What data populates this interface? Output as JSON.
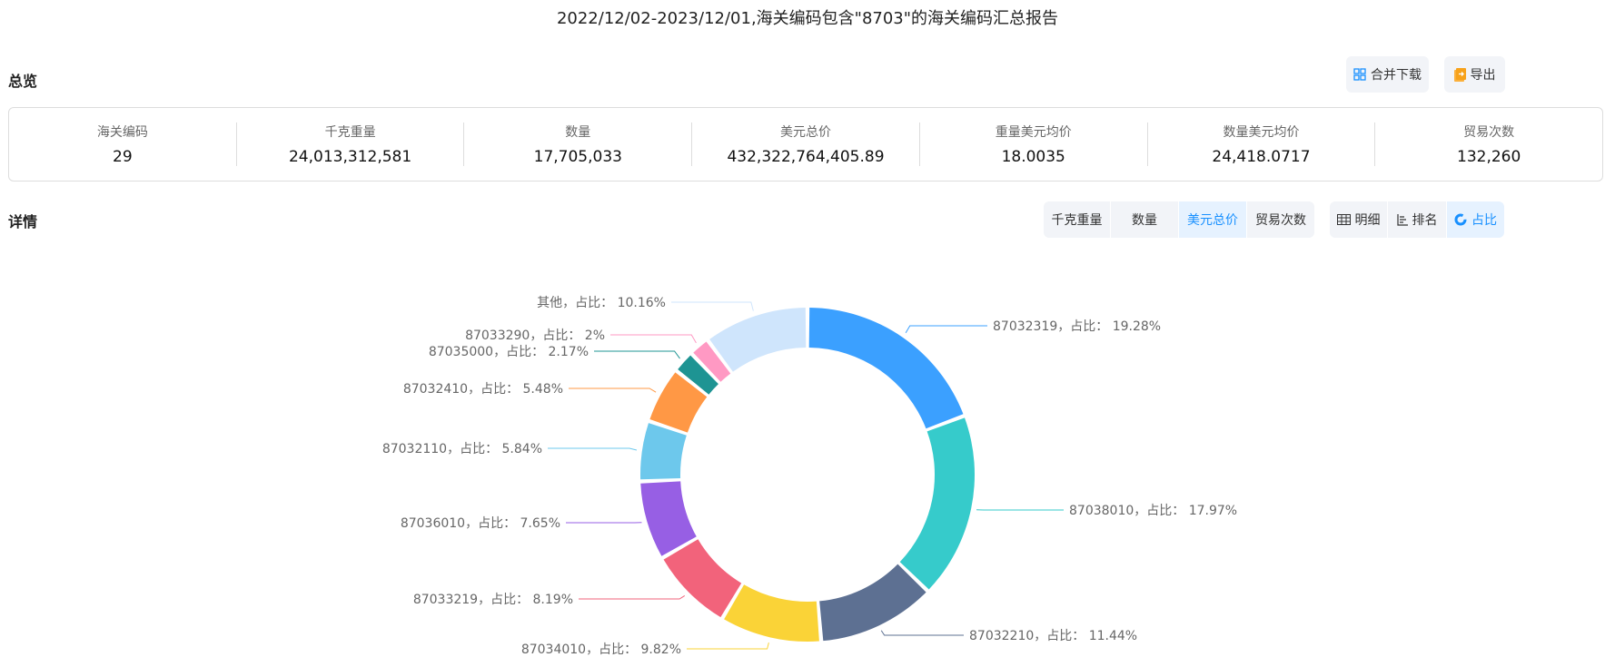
{
  "title": "2022/12/02-2023/12/01,海关编码包含\"8703\"的海关编码汇总报告",
  "overview": {
    "heading": "总览",
    "merge_download_label": "合并下载",
    "export_label": "导出",
    "stats": [
      {
        "label": "海关编码",
        "value": "29"
      },
      {
        "label": "千克重量",
        "value": "24,013,312,581"
      },
      {
        "label": "数量",
        "value": "17,705,033"
      },
      {
        "label": "美元总价",
        "value": "432,322,764,405.89"
      },
      {
        "label": "重量美元均价",
        "value": "18.0035"
      },
      {
        "label": "数量美元均价",
        "value": "24,418.0717"
      },
      {
        "label": "贸易次数",
        "value": "132,260"
      }
    ]
  },
  "details": {
    "heading": "详情",
    "metric_tabs": [
      {
        "label": "千克重量",
        "active": false
      },
      {
        "label": "数量",
        "active": false
      },
      {
        "label": "美元总价",
        "active": true
      },
      {
        "label": "贸易次数",
        "active": false
      }
    ],
    "view_tabs": [
      {
        "label": "明细",
        "icon": "table-icon",
        "active": false
      },
      {
        "label": "排名",
        "icon": "ranking-icon",
        "active": false
      },
      {
        "label": "占比",
        "icon": "donut-icon",
        "active": true
      }
    ]
  },
  "colors": {
    "accent": "#1890ff",
    "active_bg": "#e6f2ff",
    "button_bg": "#f2f4f8"
  },
  "chart_data": {
    "type": "pie",
    "style": "donut",
    "label_format": "{name}，占比： {value}%",
    "slices": [
      {
        "name": "87032319",
        "value": 19.28,
        "label": "87032319，占比： 19.28%",
        "color": "#3ba0ff"
      },
      {
        "name": "87038010",
        "value": 17.97,
        "label": "87038010，占比： 17.97%",
        "color": "#36cbcb"
      },
      {
        "name": "87032210",
        "value": 11.44,
        "label": "87032210，占比： 11.44%",
        "color": "#5d7092"
      },
      {
        "name": "87034010",
        "value": 9.82,
        "label": "87034010，占比： 9.82%",
        "color": "#fad337"
      },
      {
        "name": "87033219",
        "value": 8.19,
        "label": "87033219，占比： 8.19%",
        "color": "#f2637b"
      },
      {
        "name": "87036010",
        "value": 7.65,
        "label": "87036010，占比： 7.65%",
        "color": "#975fe4"
      },
      {
        "name": "87032110",
        "value": 5.84,
        "label": "87032110，占比： 5.84%",
        "color": "#6dc8ec"
      },
      {
        "name": "87032410",
        "value": 5.48,
        "label": "87032410，占比： 5.48%",
        "color": "#ff9845"
      },
      {
        "name": "87035000",
        "value": 2.17,
        "label": "87035000，占比： 2.17%",
        "color": "#1e9493"
      },
      {
        "name": "87033290",
        "value": 2,
        "label": "87033290，占比： 2%",
        "color": "#ff99c3"
      },
      {
        "name": "其他",
        "value": 10.16,
        "label": "其他，占比： 10.16%",
        "color": "#cfe5fc"
      }
    ]
  }
}
